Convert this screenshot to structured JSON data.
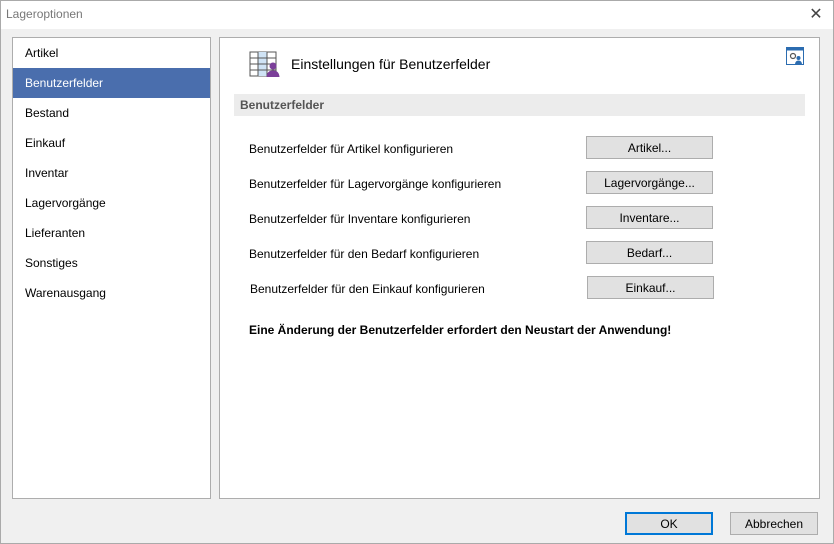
{
  "window": {
    "title": "Lageroptionen",
    "close_glyph": "✕"
  },
  "sidebar": {
    "selected_index": 1,
    "items": [
      {
        "label": "Artikel"
      },
      {
        "label": "Benutzerfelder"
      },
      {
        "label": "Bestand"
      },
      {
        "label": "Einkauf"
      },
      {
        "label": "Inventar"
      },
      {
        "label": "Lagervorgänge"
      },
      {
        "label": "Lieferanten"
      },
      {
        "label": "Sonstiges"
      },
      {
        "label": "Warenausgang"
      }
    ]
  },
  "main": {
    "header_title": "Einstellungen für Benutzerfelder",
    "header_icon": "table-user-icon",
    "corner_icon": "settings-user-icon",
    "section_title": "Benutzerfelder",
    "rows": [
      {
        "label": "Benutzerfelder für Artikel konfigurieren",
        "button": "Artikel..."
      },
      {
        "label": "Benutzerfelder für Lagervorgänge konfigurieren",
        "button": "Lagervorgänge..."
      },
      {
        "label": "Benutzerfelder für Inventare konfigurieren",
        "button": "Inventare..."
      },
      {
        "label": "Benutzerfelder für den Bedarf konfigurieren",
        "button": "Bedarf..."
      },
      {
        "label": "Benutzerfelder für den Einkauf konfigurieren",
        "button": "Einkauf..."
      }
    ],
    "notice": "Eine Änderung der Benutzerfelder erfordert den Neustart der Anwendung!"
  },
  "footer": {
    "ok_label": "OK",
    "cancel_label": "Abbrechen"
  },
  "colors": {
    "selection": "#4a6ead",
    "accent_icon": "#7b3f99",
    "default_button_border": "#0078d7"
  }
}
